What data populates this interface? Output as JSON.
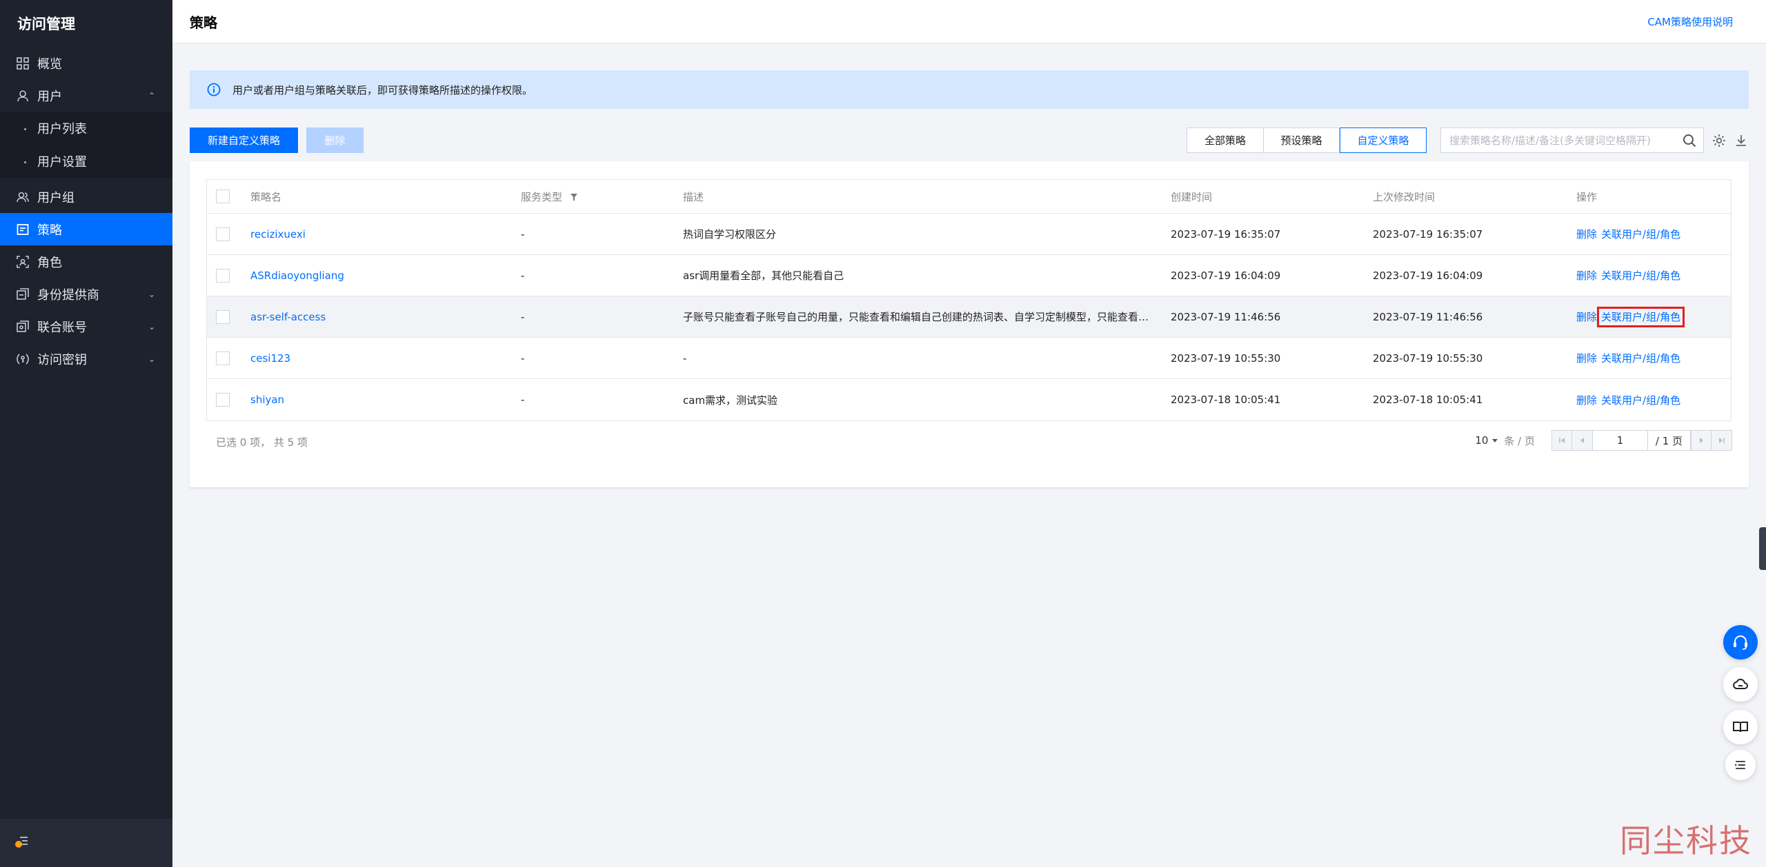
{
  "sidebar": {
    "title": "访问管理",
    "items": [
      {
        "label": "概览"
      },
      {
        "label": "用户",
        "arrow": "⌃"
      },
      {
        "label": "用户列表"
      },
      {
        "label": "用户设置"
      },
      {
        "label": "用户组"
      },
      {
        "label": "策略"
      },
      {
        "label": "角色"
      },
      {
        "label": "身份提供商",
        "arrow": "⌄"
      },
      {
        "label": "联合账号",
        "arrow": "⌄"
      },
      {
        "label": "访问密钥",
        "arrow": "⌄"
      }
    ]
  },
  "header": {
    "title": "策略",
    "doc_link": "CAM策略使用说明"
  },
  "notice": {
    "text": "用户或者用户组与策略关联后，即可获得策略所描述的操作权限。"
  },
  "toolbar": {
    "create_label": "新建自定义策略",
    "delete_label": "删除",
    "tabs": [
      "全部策略",
      "预设策略",
      "自定义策略"
    ],
    "active_tab": "自定义策略",
    "search_placeholder": "搜索策略名称/描述/备注(多关键词空格隔开)"
  },
  "table": {
    "headers": {
      "name": "策略名",
      "service": "服务类型",
      "desc": "描述",
      "created": "创建时间",
      "modified": "上次修改时间",
      "ops": "操作"
    },
    "rows": [
      {
        "name": "recizixuexi",
        "service": "-",
        "desc": "热词自学习权限区分",
        "created": "2023-07-19 16:35:07",
        "modified": "2023-07-19 16:35:07",
        "op_delete": "删除",
        "op_link": "关联用户/组/角色"
      },
      {
        "name": "ASRdiaoyongliang",
        "service": "-",
        "desc": "asr调用量看全部，其他只能看自己",
        "created": "2023-07-19 16:04:09",
        "modified": "2023-07-19 16:04:09",
        "op_delete": "删除",
        "op_link": "关联用户/组/角色"
      },
      {
        "name": "asr-self-access",
        "service": "-",
        "desc": "子账号只能查看子账号自己的用量，只能查看和编辑自己创建的热词表、自学习定制模型，只能查看自己的调用记录",
        "created": "2023-07-19 11:46:56",
        "modified": "2023-07-19 11:46:56",
        "op_delete": "删除",
        "op_link": "关联用户/组/角色"
      },
      {
        "name": "cesi123",
        "service": "-",
        "desc": "-",
        "created": "2023-07-19 10:55:30",
        "modified": "2023-07-19 10:55:30",
        "op_delete": "删除",
        "op_link": "关联用户/组/角色"
      },
      {
        "name": "shiyan",
        "service": "-",
        "desc": "cam需求，测试实验",
        "created": "2023-07-18 10:05:41",
        "modified": "2023-07-18 10:05:41",
        "op_delete": "删除",
        "op_link": "关联用户/组/角色"
      }
    ]
  },
  "footer": {
    "selection": "已选 0 项， 共 5 项",
    "page_size": "10",
    "page_unit": "条 / 页",
    "current_page": "1",
    "total_pages": "/ 1 页"
  },
  "watermark": "同尘科技",
  "colors": {
    "primary": "#006eff",
    "sidebar_bg": "#1e222d",
    "notice_bg": "#d5e7ff",
    "highlight": "#e02020"
  }
}
